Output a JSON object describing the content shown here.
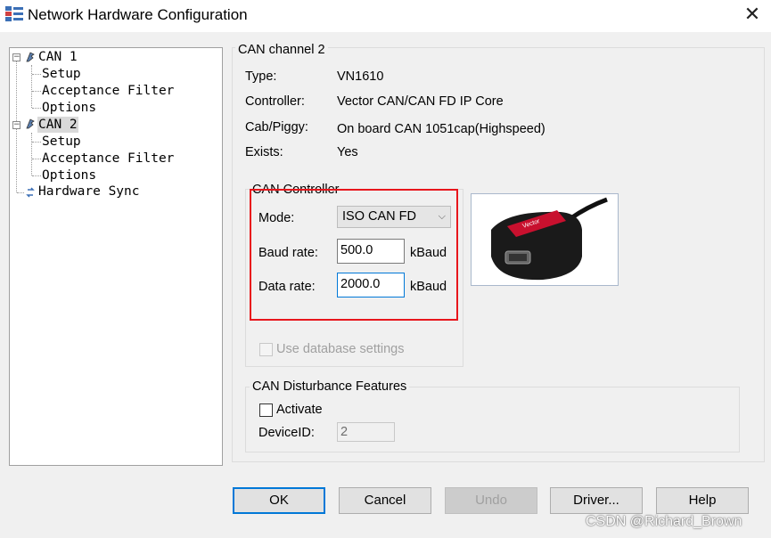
{
  "window": {
    "title": "Network Hardware Configuration",
    "icon": "network-config-icon",
    "close_icon": "close-icon"
  },
  "tree": {
    "can1": {
      "label": "CAN 1",
      "children": [
        "Setup",
        "Acceptance Filter",
        "Options"
      ]
    },
    "can2": {
      "label": "CAN 2",
      "children": [
        "Setup",
        "Acceptance Filter",
        "Options"
      ]
    },
    "hardware_sync": {
      "label": "Hardware Sync"
    }
  },
  "channel": {
    "heading": "CAN channel 2",
    "type_label": "Type:",
    "type_value": "VN1610",
    "controller_label": "Controller:",
    "controller_value": "Vector CAN/CAN FD IP Core",
    "cab_label": "Cab/Piggy:",
    "cab_value": "On board CAN 1051cap(Highspeed)",
    "exists_label": "Exists:",
    "exists_value": "Yes"
  },
  "can_controller": {
    "title": "CAN Controller",
    "mode_label": "Mode:",
    "mode_value": "ISO CAN FD",
    "baud_label": "Baud rate:",
    "baud_value": "500.0",
    "baud_unit": "kBaud",
    "data_label": "Data rate:",
    "data_value": "2000.0",
    "data_unit": "kBaud",
    "use_db_label": "Use database settings"
  },
  "disturbance": {
    "title": "CAN Disturbance Features",
    "activate_label": "Activate",
    "device_label": "DeviceID:",
    "device_value": "2"
  },
  "buttons": {
    "ok": "OK",
    "cancel": "Cancel",
    "undo": "Undo",
    "driver": "Driver...",
    "help": "Help"
  },
  "watermark": "CSDN @Richard_Brown",
  "colors": {
    "highlight_border": "#e8161c",
    "focus_border": "#0078d7",
    "device_red": "#c8102e"
  }
}
